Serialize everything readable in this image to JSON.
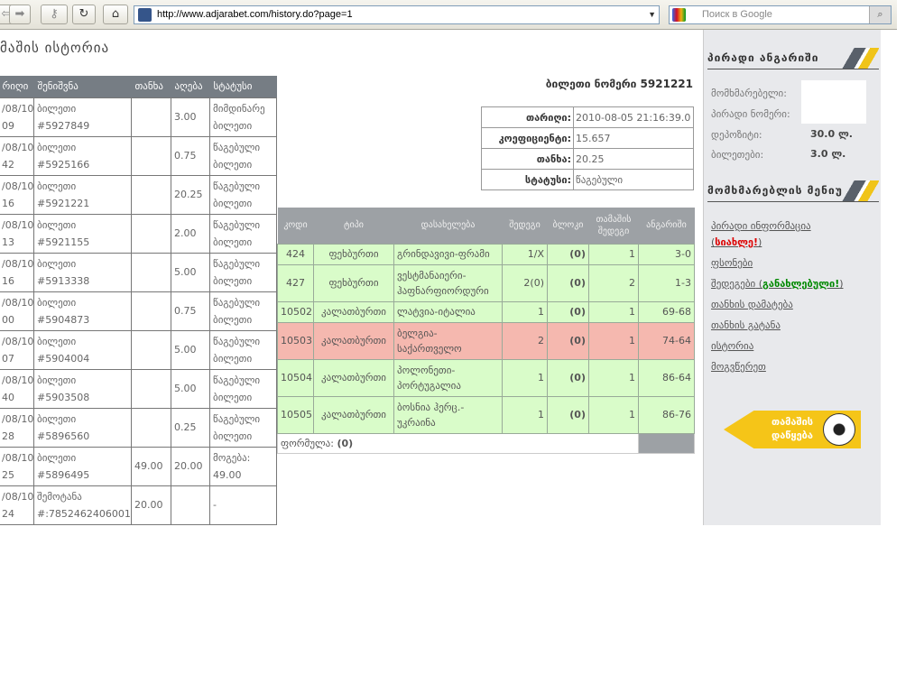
{
  "browser": {
    "url": "http://www.adjarabet.com/history.do?page=1",
    "search_placeholder": "Поиск в Google"
  },
  "page_title": "მაშის ისტორია",
  "history": {
    "headers": [
      "რიღი",
      "შენიშვნა",
      "თანხა",
      "აღება",
      "სტატუსი"
    ],
    "rows": [
      {
        "date": "/08/10 09",
        "note": "ბილეთი #5927849",
        "amount": "",
        "take": "3.00",
        "status": "მიმდინარე ბილეთი"
      },
      {
        "date": "/08/10 42",
        "note": "ბილეთი #5925166",
        "amount": "",
        "take": "0.75",
        "status": "წაგებული ბილეთი"
      },
      {
        "date": "/08/10 16",
        "note": "ბილეთი #5921221",
        "amount": "",
        "take": "20.25",
        "status": "წაგებული ბილეთი"
      },
      {
        "date": "/08/10 13",
        "note": "ბილეთი #5921155",
        "amount": "",
        "take": "2.00",
        "status": "წაგებული ბილეთი"
      },
      {
        "date": "/08/10 16",
        "note": "ბილეთი #5913338",
        "amount": "",
        "take": "5.00",
        "status": "წაგებული ბილეთი"
      },
      {
        "date": "/08/10 00",
        "note": "ბილეთი #5904873",
        "amount": "",
        "take": "0.75",
        "status": "წაგებული ბილეთი"
      },
      {
        "date": "/08/10 07",
        "note": "ბილეთი #5904004",
        "amount": "",
        "take": "5.00",
        "status": "წაგებული ბილეთი"
      },
      {
        "date": "/08/10 40",
        "note": "ბილეთი #5903508",
        "amount": "",
        "take": "5.00",
        "status": "წაგებული ბილეთი"
      },
      {
        "date": "/08/10 28",
        "note": "ბილეთი #5896560",
        "amount": "",
        "take": "0.25",
        "status": "წაგებული ბილეთი"
      },
      {
        "date": "/08/10 25",
        "note": "ბილეთი #5896495",
        "amount": "49.00",
        "take": "20.00",
        "status": "მოგება: 49.00"
      },
      {
        "date": "/08/10 24",
        "note": "შემოტანა #:7852462406001",
        "amount": "20.00",
        "take": "",
        "status": "-"
      }
    ]
  },
  "ticket": {
    "title": "ბილეთი ნომერი 5921221",
    "fields": [
      {
        "label": "თარიღი:",
        "value": "2010-08-05 21:16:39.0"
      },
      {
        "label": "კოეფიციენტი:",
        "value": "15.657"
      },
      {
        "label": "თანხა:",
        "value": "20.25"
      },
      {
        "label": "სტატუსი:",
        "value": "წაგებული"
      }
    ]
  },
  "bets": {
    "headers": [
      "კოდი",
      "ტიპი",
      "დასახელება",
      "შედეგი",
      "ბლოკი",
      "თამაშის შედეგი",
      "ანგარიში"
    ],
    "rows": [
      {
        "code": "424",
        "type": "ფეხბურთი",
        "name": "გრინდავივი-ფრამი",
        "outcome": "1/X",
        "block": "(0)",
        "result": "1",
        "score": "3-0",
        "state": "green"
      },
      {
        "code": "427",
        "type": "ფეხბურთი",
        "name": "ვესტმანაიერი-ჰაფნარფიორდური",
        "outcome": "2(0)",
        "block": "(0)",
        "result": "2",
        "score": "1-3",
        "state": "green"
      },
      {
        "code": "10502",
        "type": "კალათბურთი",
        "name": "ლატვია-იტალია",
        "outcome": "1",
        "block": "(0)",
        "result": "1",
        "score": "69-68",
        "state": "green"
      },
      {
        "code": "10503",
        "type": "კალათბურთი",
        "name": "ბელგია-საქართველო",
        "outcome": "2",
        "block": "(0)",
        "result": "1",
        "score": "74-64",
        "state": "red"
      },
      {
        "code": "10504",
        "type": "კალათბურთი",
        "name": "პოლონეთი-პორტუგალია",
        "outcome": "1",
        "block": "(0)",
        "result": "1",
        "score": "86-64",
        "state": "green"
      },
      {
        "code": "10505",
        "type": "კალათბურთი",
        "name": "ბოსნია ჰერც.-უკრაინა",
        "outcome": "1",
        "block": "(0)",
        "result": "1",
        "score": "86-76",
        "state": "green"
      }
    ],
    "formula_label": "ფორმულა:",
    "formula_value": "(0)"
  },
  "account": {
    "title": "პირადი ანგარიში",
    "user_label": "მომხმარებელი:",
    "id_label": "პირადი ნომერი:",
    "deposit_label": "დეპოზიტი:",
    "deposit_value": "30.0 ლ.",
    "tickets_label": "ბილეთები:",
    "tickets_value": "3.0 ლ."
  },
  "menu": {
    "title": "მომხმარებლის მენიუ",
    "items": [
      "პირადი ინფორმაცია",
      "ფსონები",
      "შედეგები",
      "თანხის დამატება",
      "თანხის გატანა",
      "ისტორია",
      "მოგვწერეთ"
    ],
    "new_badge": "სიახლე!",
    "updated_badge": "განახლებული!"
  },
  "play_button": "თამაშის დაწყება"
}
